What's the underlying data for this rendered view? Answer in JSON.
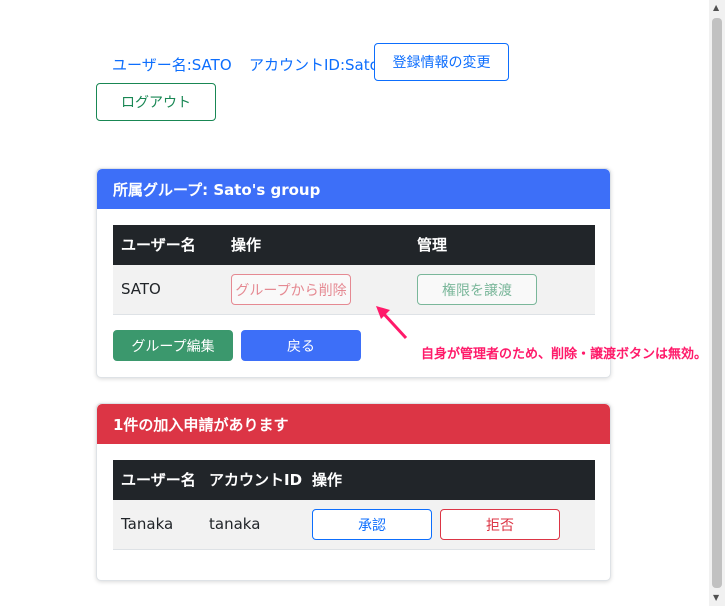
{
  "header": {
    "username": "ユーザー名:SATO",
    "account_id": "アカウントID:Sato",
    "edit_profile_button": "登録情報の変更",
    "logout_button": "ログアウト"
  },
  "group_card": {
    "title": "所属グループ: Sato's group",
    "columns": [
      "ユーザー名",
      "操作",
      "管理"
    ],
    "row": {
      "username": "SATO",
      "remove_button": "グループから削除",
      "transfer_button": "権限を譲渡"
    },
    "edit_group_button": "グループ編集",
    "back_button": "戻る",
    "accent_color": "#3d6ff8"
  },
  "annotation": {
    "text": "自身が管理者のため、削除・譲渡ボタンは無効。",
    "color": "#ff1a6a"
  },
  "request_card": {
    "title": "1件の加入申請があります",
    "columns": [
      "ユーザー名",
      "アカウントID",
      "操作"
    ],
    "row": {
      "username": "Tanaka",
      "account_id": "tanaka",
      "approve_button": "承認",
      "reject_button": "拒否"
    },
    "accent_color": "#dc3545"
  },
  "icons": [
    "arrow-icon",
    "scroll-up-icon",
    "scroll-down-icon"
  ]
}
